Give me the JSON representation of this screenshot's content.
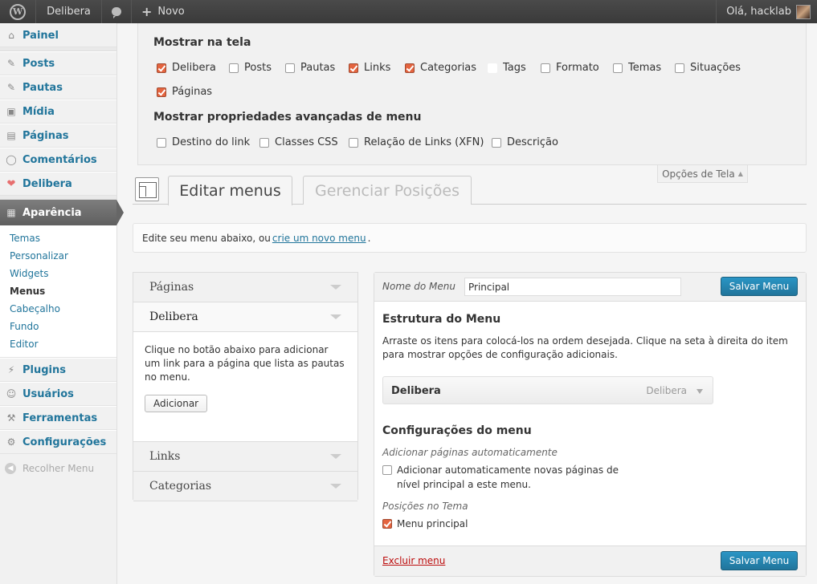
{
  "adminbar": {
    "site_name": "Delibera",
    "new_label": "Novo",
    "greeting": "Olá, hacklab"
  },
  "sidebar": {
    "items": [
      {
        "label": "Painel",
        "icon": "dashboard-icon"
      },
      {
        "label": "Posts",
        "icon": "pin-icon"
      },
      {
        "label": "Pautas",
        "icon": "pin-icon"
      },
      {
        "label": "Mídia",
        "icon": "media-icon"
      },
      {
        "label": "Páginas",
        "icon": "pages-icon"
      },
      {
        "label": "Comentários",
        "icon": "comments-icon"
      },
      {
        "label": "Delibera",
        "icon": "heart-icon"
      },
      {
        "label": "Aparência",
        "icon": "appearance-icon"
      },
      {
        "label": "Plugins",
        "icon": "plugins-icon"
      },
      {
        "label": "Usuários",
        "icon": "users-icon"
      },
      {
        "label": "Ferramentas",
        "icon": "tools-icon"
      },
      {
        "label": "Configurações",
        "icon": "settings-icon"
      }
    ],
    "submenu": [
      "Temas",
      "Personalizar",
      "Widgets",
      "Menus",
      "Cabeçalho",
      "Fundo",
      "Editor"
    ],
    "collapse_label": "Recolher Menu"
  },
  "screen_options": {
    "title_show": "Mostrar na tela",
    "boxes": [
      {
        "label": "Delibera",
        "checked": true
      },
      {
        "label": "Posts",
        "checked": false
      },
      {
        "label": "Pautas",
        "checked": false
      },
      {
        "label": "Links",
        "checked": true
      },
      {
        "label": "Categorias",
        "checked": true
      },
      {
        "label": "Tags",
        "checked": false
      },
      {
        "label": "Formato",
        "checked": false
      },
      {
        "label": "Temas",
        "checked": false
      },
      {
        "label": "Situações",
        "checked": false
      },
      {
        "label": "Páginas",
        "checked": true
      }
    ],
    "title_advanced": "Mostrar propriedades avançadas de menu",
    "advanced": [
      {
        "label": "Destino do link",
        "checked": false
      },
      {
        "label": "Classes CSS",
        "checked": false
      },
      {
        "label": "Relação de Links (XFN)",
        "checked": false
      },
      {
        "label": "Descrição",
        "checked": false
      }
    ],
    "tab_label": "Opções de Tela"
  },
  "tabs": {
    "edit": "Editar menus",
    "manage": "Gerenciar Posições"
  },
  "info": {
    "text_before": "Edite seu menu abaixo, ou",
    "link": "crie um novo menu",
    "text_after": "."
  },
  "accordion": {
    "sections": [
      "Páginas",
      "Delibera",
      "Links",
      "Categorias"
    ],
    "delibera_text": "Clique no botão abaixo para adicionar um link para a página que lista as pautas no menu.",
    "add_button": "Adicionar"
  },
  "menu": {
    "name_label": "Nome do Menu",
    "name_value": "Principal",
    "save_label": "Salvar Menu",
    "structure_title": "Estrutura do Menu",
    "structure_desc": "Arraste os itens para colocá-los na ordem desejada. Clique na seta à direita do item para mostrar opções de configuração adicionais.",
    "item": {
      "title": "Delibera",
      "type": "Delibera"
    },
    "settings_title": "Configurações do menu",
    "auto_add_label": "Adicionar páginas automaticamente",
    "auto_add_text": "Adicionar automaticamente novas páginas de nível principal a este menu.",
    "locations_label": "Posições no Tema",
    "location_primary": "Menu principal",
    "delete_link": "Excluir menu"
  },
  "colors": {
    "link": "#21759b",
    "primary_button": "#21759b",
    "checkbox_checked": "#e4643f",
    "delete": "#bc0b0b"
  }
}
